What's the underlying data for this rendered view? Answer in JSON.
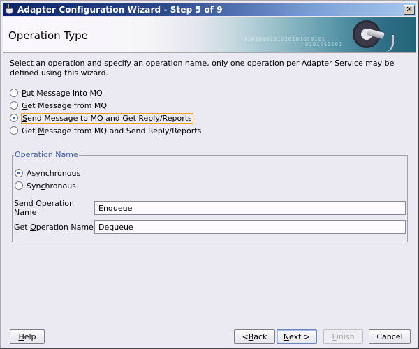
{
  "window": {
    "title": "Adapter Configuration Wizard - Step 5 of 9",
    "close_label": "✕"
  },
  "header": {
    "title": "Operation Type",
    "banner_binary_1": "0101010101010101010101",
    "banner_binary_2": "0101010101"
  },
  "content": {
    "description": "Select an operation and specify an operation name, only one operation per Adapter Service may be defined using this wizard.",
    "operations": [
      {
        "mnemonic": "P",
        "rest": "ut Message into MQ",
        "checked": false
      },
      {
        "mnemonic": "G",
        "rest": "et Message from MQ",
        "checked": false
      },
      {
        "mnemonic": "S",
        "rest": "end Message to MQ and Get Reply/Reports",
        "checked": true
      },
      {
        "pre": "Get ",
        "mnemonic": "M",
        "rest": "essage from MQ and Send Reply/Reports",
        "checked": false
      }
    ]
  },
  "operation_name": {
    "legend": "Operation Name",
    "modes": [
      {
        "pre": "",
        "mnemonic": "A",
        "rest": "synchronous",
        "checked": true
      },
      {
        "pre": "Syn",
        "mnemonic": "c",
        "rest": "hronous",
        "checked": false
      }
    ],
    "send_label_pre": "S",
    "send_label_mnemonic": "e",
    "send_label_rest": "nd Operation Name",
    "send_value": "Enqueue",
    "get_label_pre": "Get ",
    "get_label_mnemonic": "O",
    "get_label_rest": "peration Name",
    "get_value": "Dequeue"
  },
  "buttons": {
    "help_mnemonic": "H",
    "help_rest": "elp",
    "back_pre": "< ",
    "back_mnemonic": "B",
    "back_rest": "ack",
    "next_mnemonic": "N",
    "next_rest": "ext >",
    "finish_mnemonic": "F",
    "finish_rest": "inish",
    "cancel": "Cancel"
  }
}
